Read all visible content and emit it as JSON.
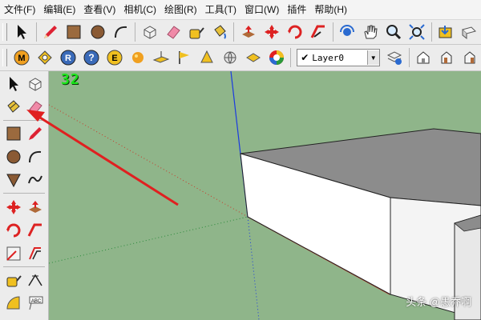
{
  "menu": [
    "文件(F)",
    "编辑(E)",
    "查看(V)",
    "相机(C)",
    "绘图(R)",
    "工具(T)",
    "窗口(W)",
    "插件",
    "帮助(H)"
  ],
  "layer": {
    "current": "Layer0",
    "check": "✔"
  },
  "viewport": {
    "counter": "32"
  },
  "watermark": "头条 @愚乔啊",
  "colors": {
    "ground": "#8fb58a",
    "accent_arrow": "#e02020",
    "wall": "#ffffff",
    "roof": "#8c8c8c",
    "blue_axis": "#1a3ae0",
    "red_axis": "#c83a2a",
    "green_axis": "#2a8a3a"
  }
}
